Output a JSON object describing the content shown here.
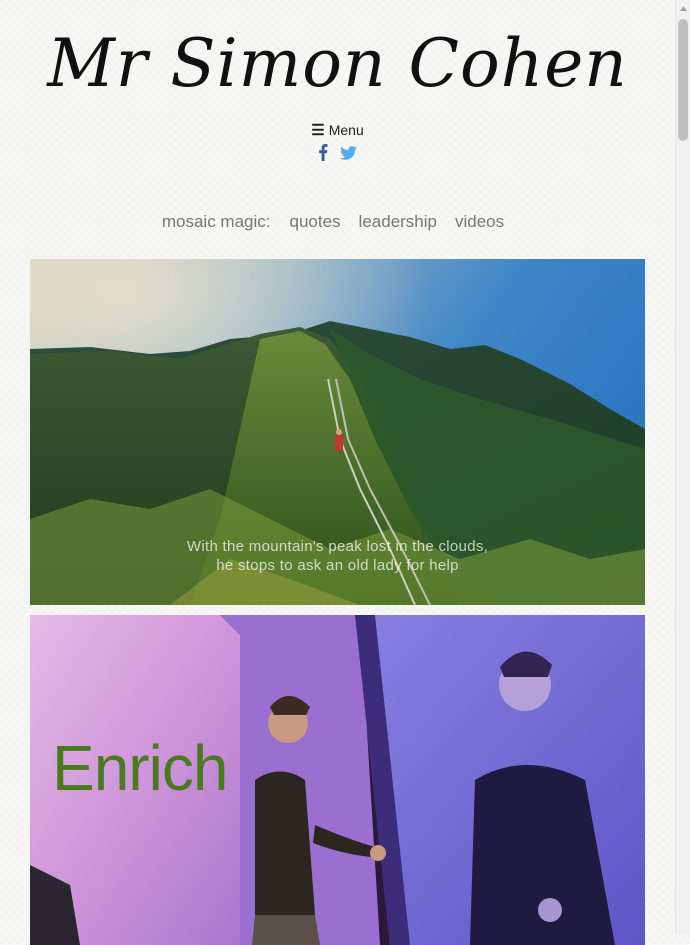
{
  "site": {
    "logo_text": "Mr Simon Cohen"
  },
  "menu": {
    "icon": "hamburger-icon",
    "label": "Menu"
  },
  "social": [
    {
      "name": "facebook",
      "icon": "facebook-icon",
      "color": "#3a5a98"
    },
    {
      "name": "twitter",
      "icon": "twitter-icon",
      "color": "#55acee"
    }
  ],
  "mosaic_nav": {
    "label": "mosaic magic:",
    "links": [
      "quotes",
      "leadership",
      "videos"
    ]
  },
  "tiles": [
    {
      "caption_line1": "With the mountain's peak lost in the clouds,",
      "caption_line2": "he stops to ask an old lady for help"
    },
    {
      "sign_text": "Enrich"
    }
  ]
}
